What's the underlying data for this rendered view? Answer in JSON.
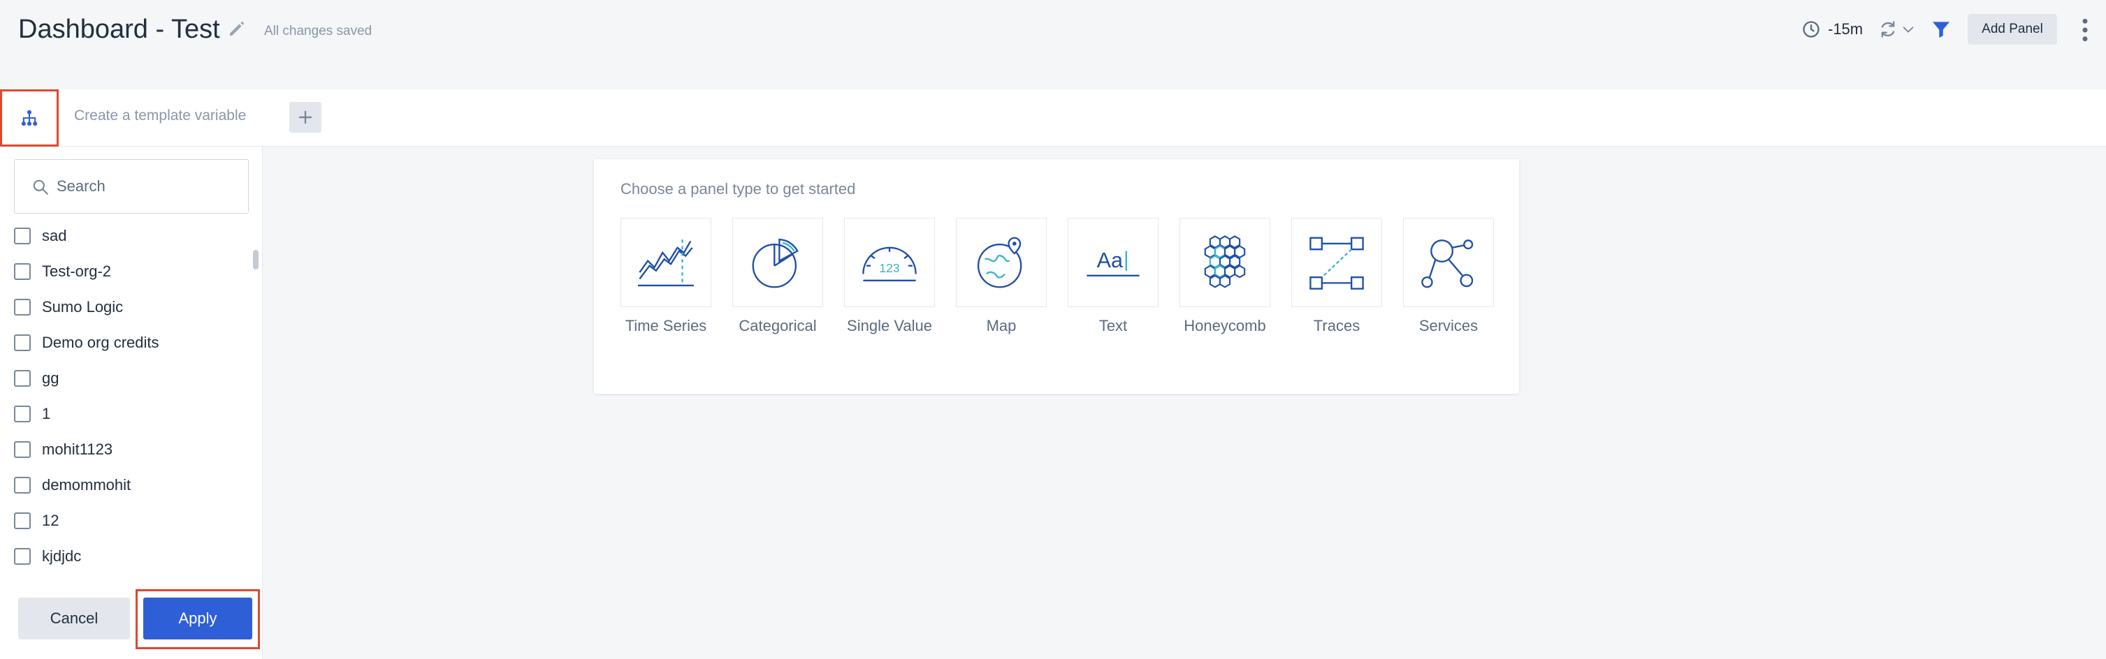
{
  "header": {
    "title": "Dashboard - Test",
    "saved_status": "All changes saved",
    "time_range": "-15m",
    "add_panel_label": "Add Panel"
  },
  "template_bar": {
    "create_label": "Create a template variable"
  },
  "filter_panel": {
    "search_placeholder": "Search",
    "items": [
      {
        "label": "sad",
        "checked": false
      },
      {
        "label": "Test-org-2",
        "checked": false
      },
      {
        "label": "Sumo Logic",
        "checked": false
      },
      {
        "label": "Demo org credits",
        "checked": false
      },
      {
        "label": "gg",
        "checked": false
      },
      {
        "label": "1",
        "checked": false
      },
      {
        "label": "mohit1123",
        "checked": false
      },
      {
        "label": "demommohit",
        "checked": false
      },
      {
        "label": "12",
        "checked": false
      },
      {
        "label": "kjdjdc",
        "checked": false
      }
    ],
    "cancel_label": "Cancel",
    "apply_label": "Apply"
  },
  "panel_chooser": {
    "prompt": "Choose a panel type to get started",
    "types": [
      {
        "label": "Time Series",
        "icon": "time-series-icon"
      },
      {
        "label": "Categorical",
        "icon": "categorical-icon"
      },
      {
        "label": "Single Value",
        "icon": "single-value-icon"
      },
      {
        "label": "Map",
        "icon": "map-icon"
      },
      {
        "label": "Text",
        "icon": "text-icon"
      },
      {
        "label": "Honeycomb",
        "icon": "honeycomb-icon"
      },
      {
        "label": "Traces",
        "icon": "traces-icon"
      },
      {
        "label": "Services",
        "icon": "services-icon"
      }
    ]
  },
  "colors": {
    "accent": "#2f5fd7",
    "highlight_outline": "#e0472f",
    "icon_blue": "#1f4fa8",
    "icon_teal": "#38b6c8"
  }
}
